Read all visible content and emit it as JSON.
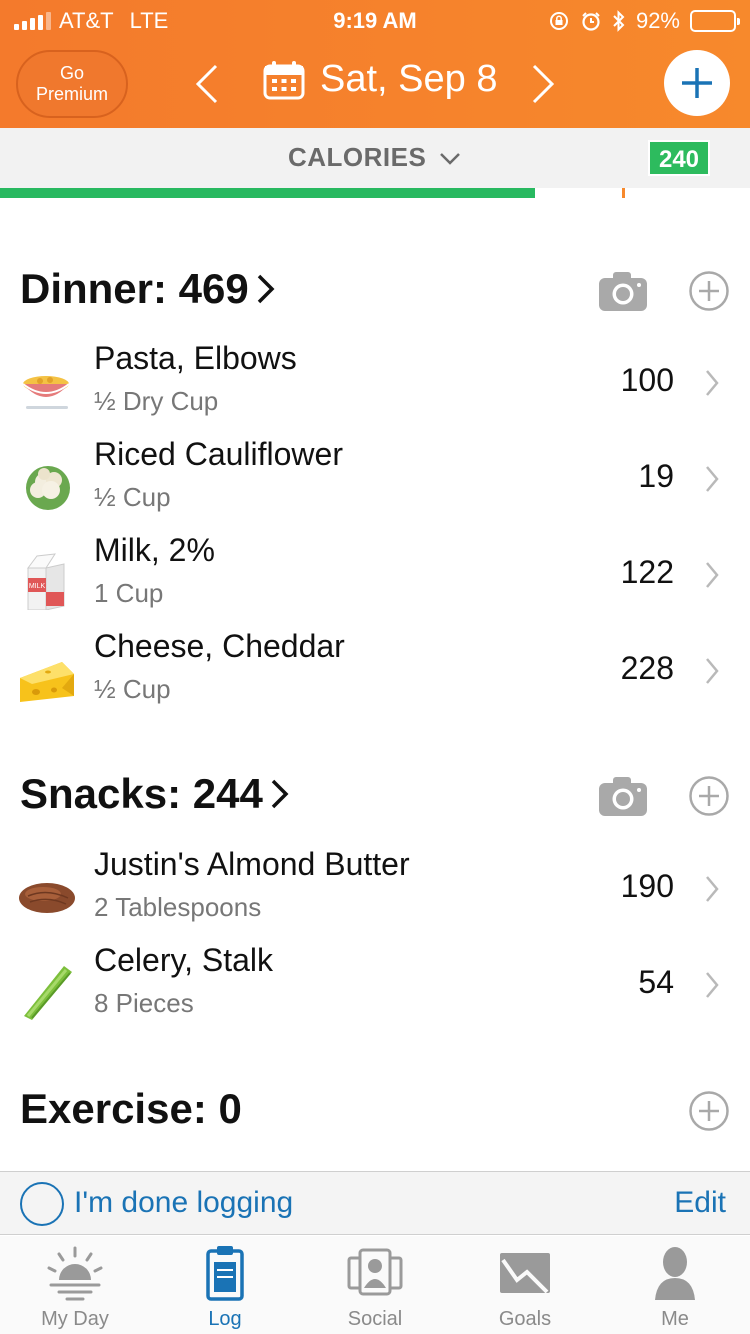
{
  "status_bar": {
    "carrier": "AT&T",
    "network": "LTE",
    "time": "9:19 AM",
    "battery": "92%"
  },
  "header": {
    "premium_line1": "Go",
    "premium_line2": "Premium",
    "date": "Sat, Sep 8",
    "accent": "#f47a2c"
  },
  "calories_bar": {
    "label": "CALORIES",
    "remaining": "240",
    "progress_fraction": 0.713
  },
  "dinner": {
    "title": "Dinner: 469",
    "items": [
      {
        "name": "Pasta, Elbows",
        "portion": "½ Dry Cup",
        "calories": "100",
        "icon": "pasta-bowl-icon"
      },
      {
        "name": "Riced Cauliflower",
        "portion": "½ Cup",
        "calories": "19",
        "icon": "cauliflower-icon"
      },
      {
        "name": "Milk, 2%",
        "portion": "1 Cup",
        "calories": "122",
        "icon": "milk-carton-icon",
        "icon_text": "MILK"
      },
      {
        "name": "Cheese, Cheddar",
        "portion": "½ Cup",
        "calories": "228",
        "icon": "cheese-icon"
      }
    ]
  },
  "snacks": {
    "title": "Snacks: 244",
    "items": [
      {
        "name": "Justin's Almond Butter",
        "portion": "2 Tablespoons",
        "calories": "190",
        "icon": "almond-icon"
      },
      {
        "name": "Celery, Stalk",
        "portion": "8 Pieces",
        "calories": "54",
        "icon": "celery-icon"
      }
    ]
  },
  "exercise": {
    "title": "Exercise: 0"
  },
  "done_bar": {
    "label": "I'm done logging",
    "edit": "Edit"
  },
  "tabs": [
    {
      "label": "My Day",
      "icon": "sunrise-icon"
    },
    {
      "label": "Log",
      "icon": "clipboard-icon",
      "active": true
    },
    {
      "label": "Social",
      "icon": "people-icon"
    },
    {
      "label": "Goals",
      "icon": "envelope-chart-icon"
    },
    {
      "label": "Me",
      "icon": "person-icon"
    }
  ]
}
